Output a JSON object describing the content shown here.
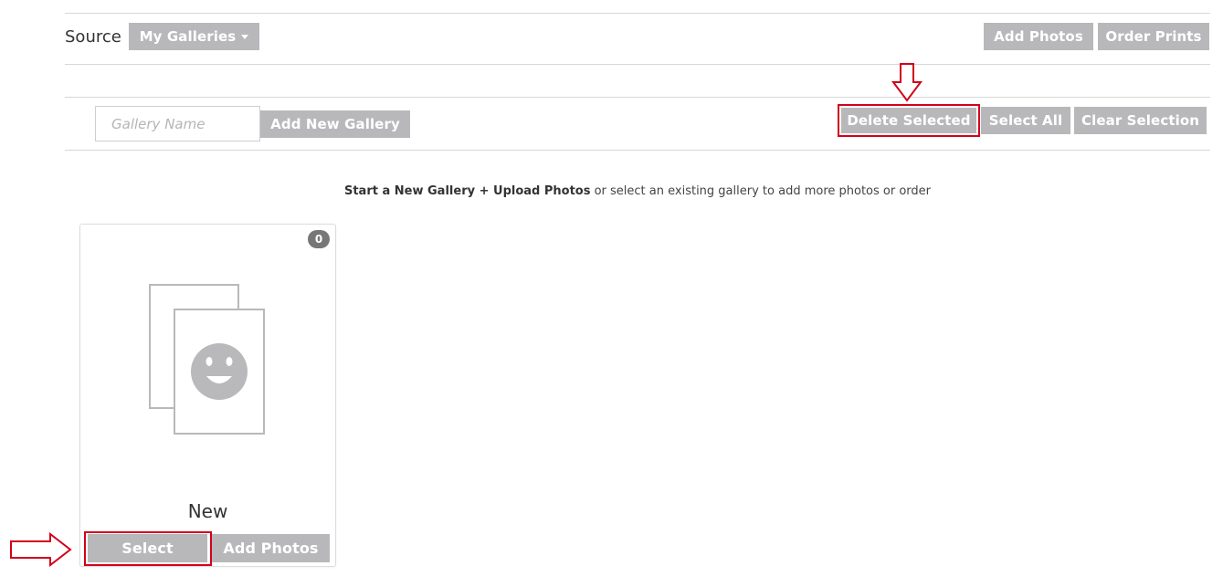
{
  "source": {
    "label": "Source",
    "galleries_dropdown": "My Galleries"
  },
  "toolbar": {
    "add_photos": "Add Photos",
    "order_prints": "Order Prints"
  },
  "gallery_form": {
    "placeholder": "Gallery Name",
    "value": "",
    "add_button": "Add New Gallery"
  },
  "selection": {
    "delete_selected": "Delete Selected",
    "select_all": "Select All",
    "clear_selection": "Clear Selection"
  },
  "hint": {
    "bold": "Start a New Gallery + Upload Photos",
    "rest": " or select an existing gallery to add more photos or order"
  },
  "galleries": [
    {
      "title": "New",
      "count": "0",
      "select_label": "Select",
      "add_photos_label": "Add Photos"
    }
  ],
  "colors": {
    "button_bg": "#b8b8bb",
    "highlight": "#d0021b",
    "badge_bg": "#777777",
    "placeholder_icon": "#b9b9bb"
  },
  "icons": {
    "placeholder": "photo-stack-smiley-icon",
    "annotation": "outline-arrow-icon"
  }
}
